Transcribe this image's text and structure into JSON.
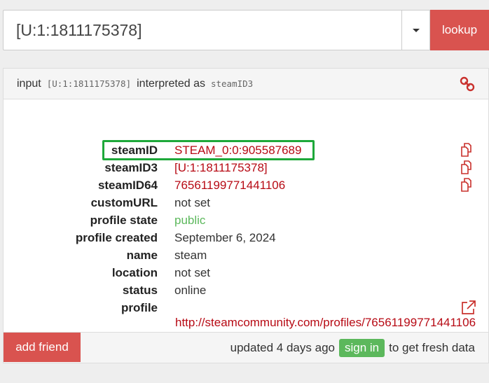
{
  "search": {
    "value": "[U:1:1811175378]",
    "lookup_label": "lookup"
  },
  "heading": {
    "prefix": "input",
    "input_code": "[U:1:1811175378]",
    "middle": "interpreted as",
    "type_code": "steamID3"
  },
  "rows": [
    {
      "label": "steamID",
      "value": "STEAM_0:0:905587689"
    },
    {
      "label": "steamID3",
      "value": "[U:1:1811175378]"
    },
    {
      "label": "steamID64",
      "value": "76561199771441106"
    },
    {
      "label": "customURL",
      "value": "not set"
    },
    {
      "label": "profile state",
      "value": "public"
    },
    {
      "label": "profile created",
      "value": "September 6, 2024"
    },
    {
      "label": "name",
      "value": "steam"
    },
    {
      "label": "location",
      "value": "not set"
    },
    {
      "label": "status",
      "value": "online"
    },
    {
      "label": "profile",
      "value": "http://steamcommunity.com/profiles/76561199771441106"
    }
  ],
  "footer": {
    "add_friend": "add friend",
    "updated": "updated 4 days ago",
    "signin": "sign in",
    "suffix": "to get fresh data"
  },
  "colors": {
    "accent_red": "#d9534f",
    "value_red": "#b70a14",
    "green": "#5cb85c",
    "highlight": "#1ea83a"
  }
}
